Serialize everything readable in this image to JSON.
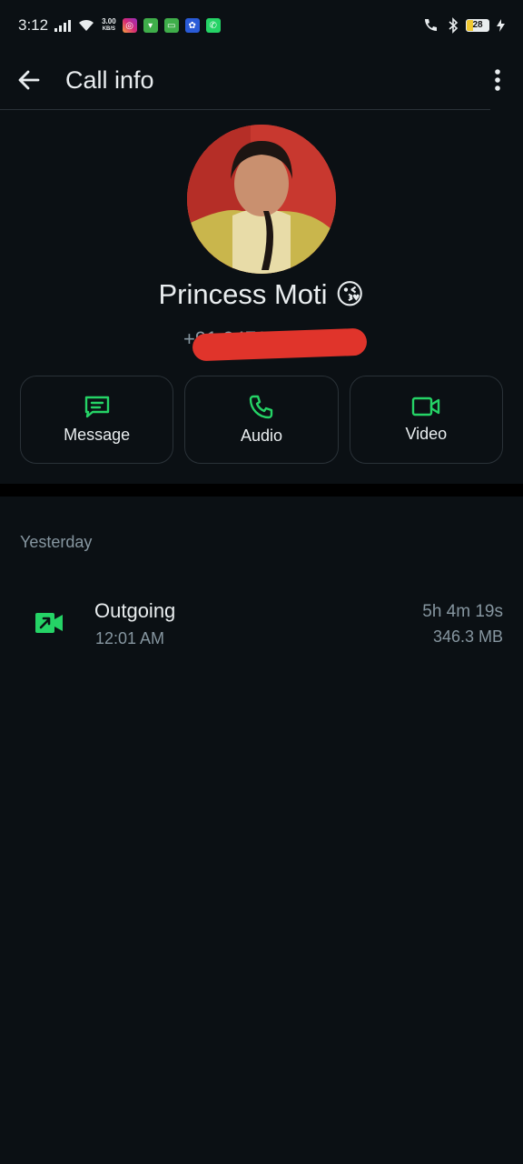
{
  "status_bar": {
    "time": "3:12",
    "net_speed_value": "3.00",
    "net_speed_unit": "KB/S",
    "battery": "28",
    "app_icons": [
      "instagram-icon",
      "gallery-app-icon",
      "messages-icon",
      "photos-app-icon",
      "whatsapp-icon"
    ]
  },
  "appbar": {
    "title": "Call info"
  },
  "contact": {
    "name": "Princess Moti 😘",
    "phone": "+91 94717 40000"
  },
  "actions": [
    {
      "label": "Message",
      "icon": "message-icon"
    },
    {
      "label": "Audio",
      "icon": "phone-icon"
    },
    {
      "label": "Video",
      "icon": "video-camera-icon"
    }
  ],
  "calls": {
    "section": "Yesterday",
    "items": [
      {
        "type": "Outgoing",
        "time": "12:01 AM",
        "duration": "5h 4m 19s",
        "size": "346.3 MB"
      }
    ]
  },
  "colors": {
    "background": "#0b1014",
    "accent": "#25d366",
    "text_primary": "#e9edef",
    "text_secondary": "#8696a0",
    "redaction": "#e0342b"
  }
}
